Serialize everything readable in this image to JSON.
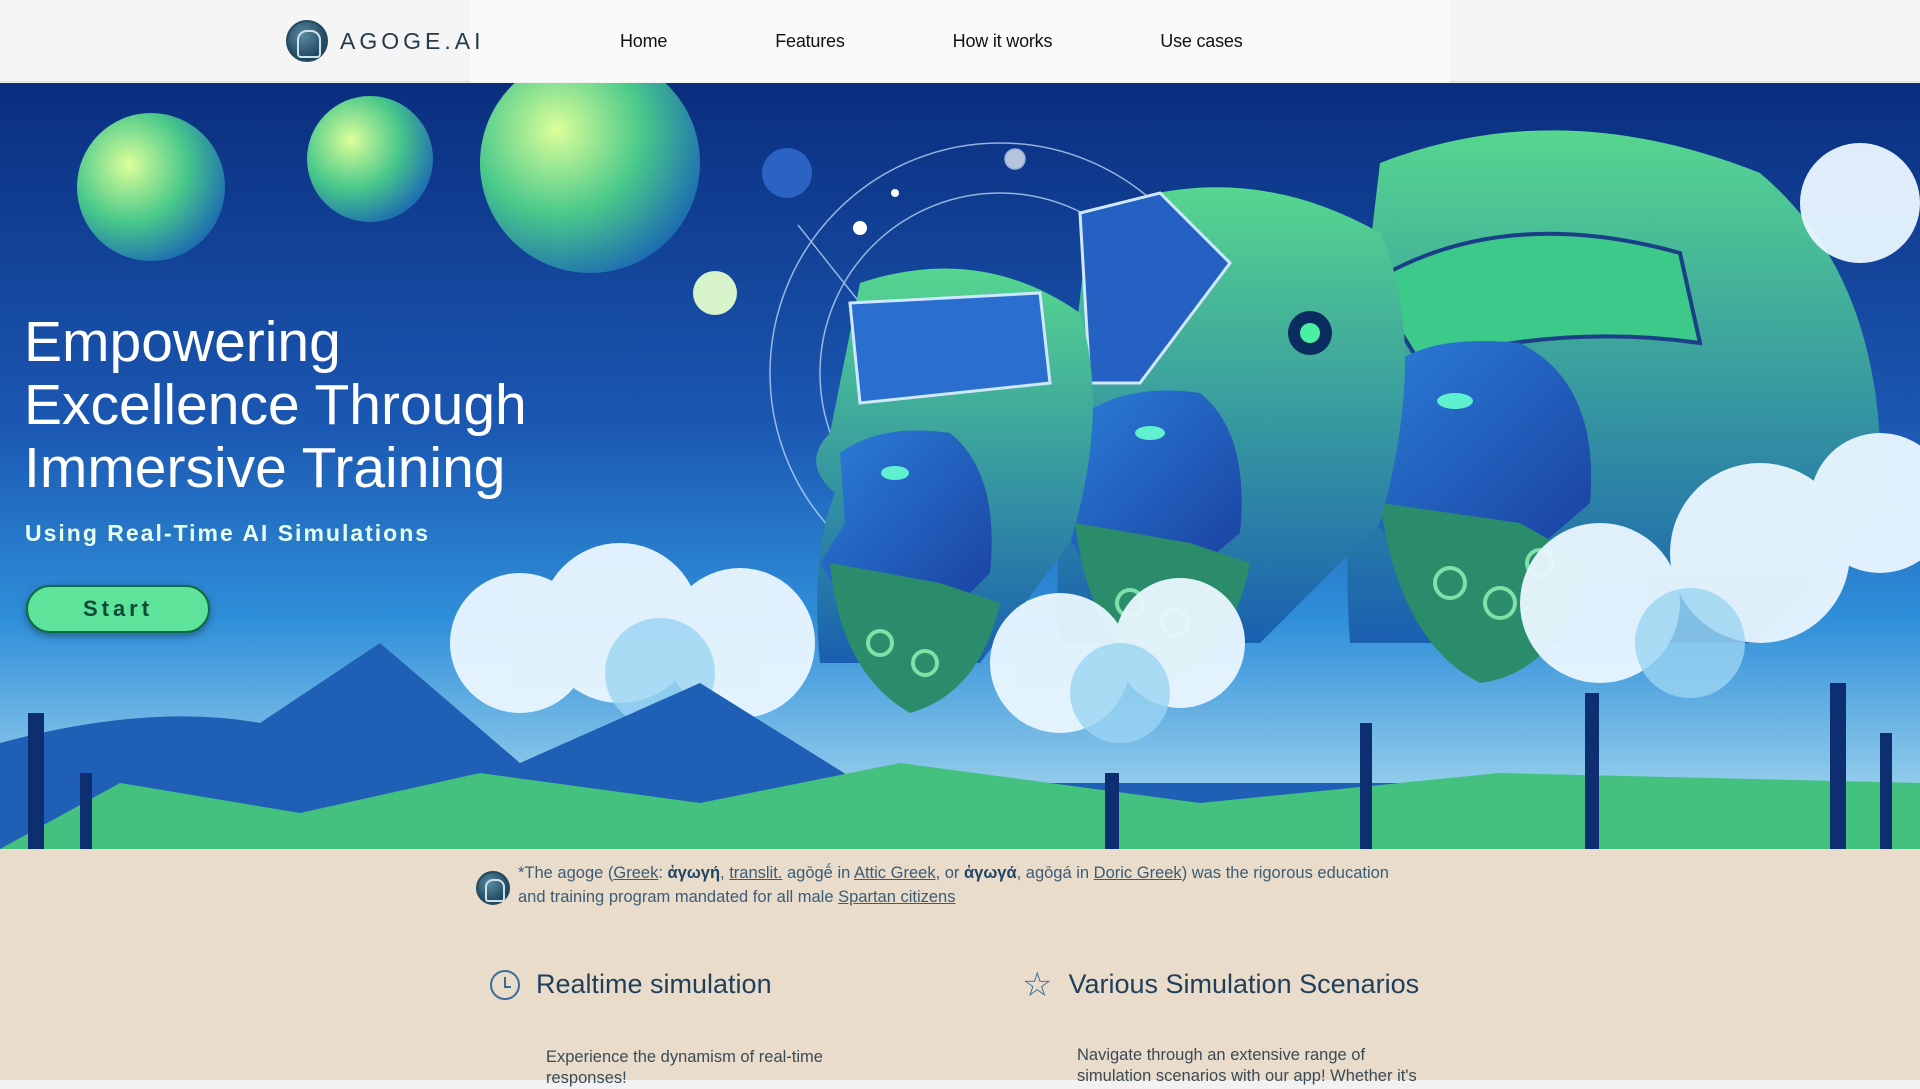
{
  "header": {
    "logo_text": "AGOGE.AI",
    "nav": [
      "Home",
      "Features",
      "How it works",
      "Use cases"
    ]
  },
  "hero": {
    "title_lines": [
      "Empowering",
      "Excellence Through",
      "Immersive Training"
    ],
    "subtitle": "Using Real-Time AI Simulations",
    "cta_label": "Start"
  },
  "note": {
    "star": "*The agoge (",
    "greek_link": "Greek",
    "colon": ": ",
    "greek_word1": "ἀγωγή",
    "comma1": ", ",
    "translit_link": "translit.",
    "translit_word1": " agōgḗ in ",
    "attic_link": "Attic Greek",
    "or_text": ", or ",
    "greek_word2": "ἀγωγά",
    "translit_word2": ", agōgá in ",
    "doric_link": "Doric Greek",
    "middle_text": ") was the rigorous education and training program mandated for all male ",
    "spartan_link": "Spartan citizens"
  },
  "features": [
    {
      "icon": "clock-icon",
      "title": "Realtime simulation",
      "desc": "Experience the dynamism of real-time responses!"
    },
    {
      "icon": "star-icon",
      "title": "Various Simulation Scenarios",
      "desc": "Navigate through an extensive range of simulation scenarios with our app! Whether it's"
    }
  ],
  "colors": {
    "hero_sky": "#1b58b3",
    "cta_fill": "#5ee39a",
    "lower_bg": "#e9dccb",
    "accent_text": "#3b5c76"
  }
}
